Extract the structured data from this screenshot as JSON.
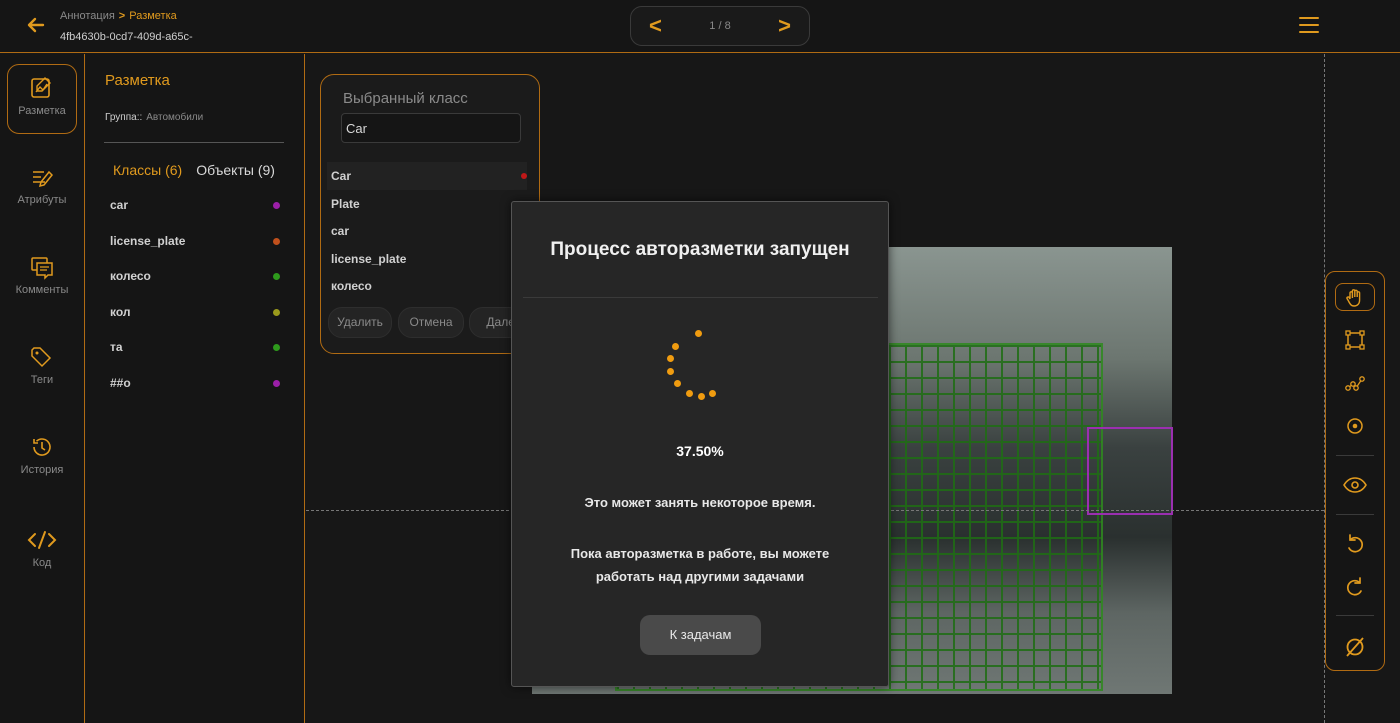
{
  "header": {
    "breadcrumb_root": "Аннотация",
    "breadcrumb_sep": ">",
    "breadcrumb_current": "Разметка",
    "task_id": "4fb4630b-0cd7-409d-a65c-",
    "pager_count": "1 / 8",
    "prev": "<",
    "next": ">"
  },
  "nav": {
    "items": [
      {
        "label": "Разметка",
        "icon": "markup-icon"
      },
      {
        "label": "Атрибуты",
        "icon": "attributes-icon"
      },
      {
        "label": "Комменты",
        "icon": "comments-icon"
      },
      {
        "label": "Теги",
        "icon": "tags-icon"
      },
      {
        "label": "История",
        "icon": "history-icon"
      },
      {
        "label": "Код",
        "icon": "code-icon"
      }
    ]
  },
  "panel": {
    "title": "Разметка",
    "group_label": "Группа::",
    "group_value": "Автомобили",
    "tab_classes": "Классы (6)",
    "tab_objects": "Объекты (9)",
    "classes": [
      {
        "name": "car",
        "color": "#9b1fa8"
      },
      {
        "name": "license_plate",
        "color": "#c0501c"
      },
      {
        "name": "колесо",
        "color": "#2e9a1c"
      },
      {
        "name": "кол",
        "color": "#9a9a1c"
      },
      {
        "name": "та",
        "color": "#2e9a1c"
      },
      {
        "name": "##о",
        "color": "#9b1fa8"
      }
    ]
  },
  "selected_class": {
    "title": "Выбранный класс",
    "value": "Car",
    "items": [
      {
        "name": "Car",
        "color": "#c01818"
      },
      {
        "name": "Plate",
        "color": "#1ca0a0"
      },
      {
        "name": "car",
        "color": "#9b1fa8"
      },
      {
        "name": "license_plate",
        "color": "#c0501c"
      },
      {
        "name": "колесо",
        "color": "#2e9a1c"
      }
    ],
    "delete_label": "Удалить",
    "cancel_label": "Отмена",
    "next_label": "Далее"
  },
  "modal": {
    "title": "Процесс авторазметки запущен",
    "progress": "37.50%",
    "message1": "Это может занять некоторое время.",
    "message2": "Пока авторазметка в работе, вы можете работать над другими задачами",
    "button_label": "К задачам"
  },
  "colors": {
    "accent": "#e09a1e",
    "grid_box": "#2f8a1f",
    "plate_box": "#9b2fb0"
  }
}
